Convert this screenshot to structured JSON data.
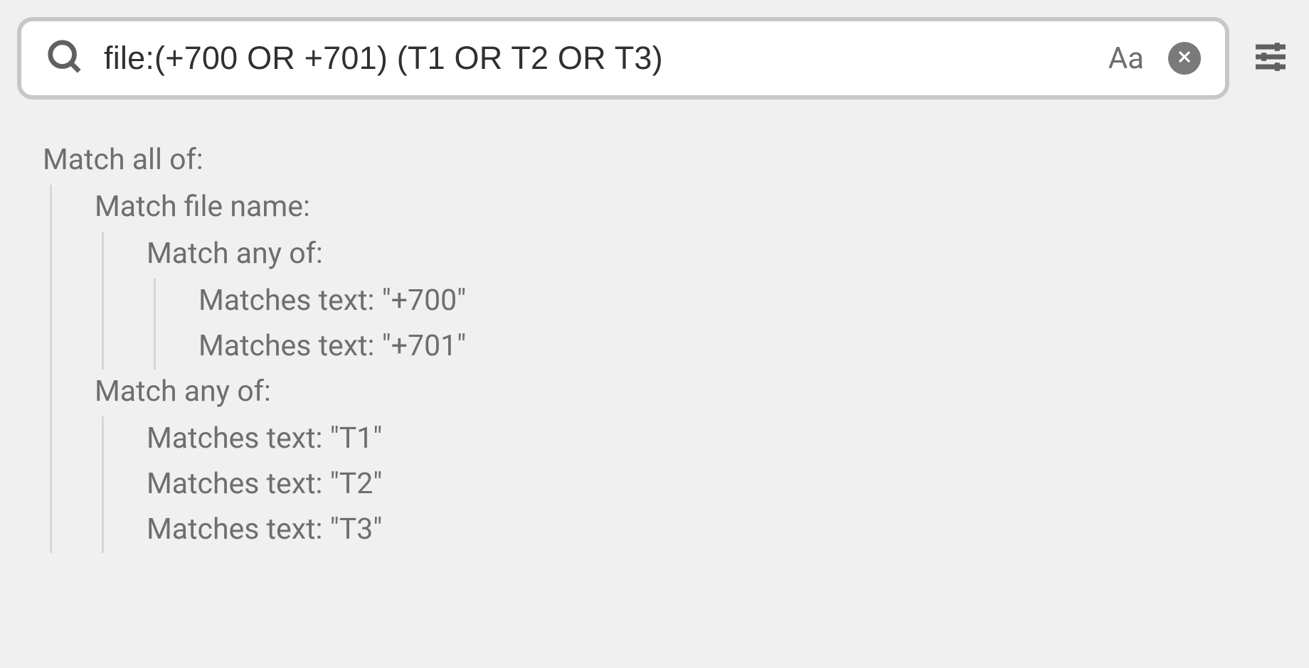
{
  "search": {
    "query": "file:(+700 OR +701) (T1 OR T2 OR T3)",
    "case_label": "Aa"
  },
  "explain": {
    "root_label": "Match all of:",
    "children": [
      {
        "label": "Match file name:",
        "children": [
          {
            "label": "Match any of:",
            "children": [
              {
                "label": "Matches text: \"+700\""
              },
              {
                "label": "Matches text: \"+701\""
              }
            ]
          }
        ]
      },
      {
        "label": "Match any of:",
        "children": [
          {
            "label": "Matches text: \"T1\""
          },
          {
            "label": "Matches text: \"T2\""
          },
          {
            "label": "Matches text: \"T3\""
          }
        ]
      }
    ]
  }
}
